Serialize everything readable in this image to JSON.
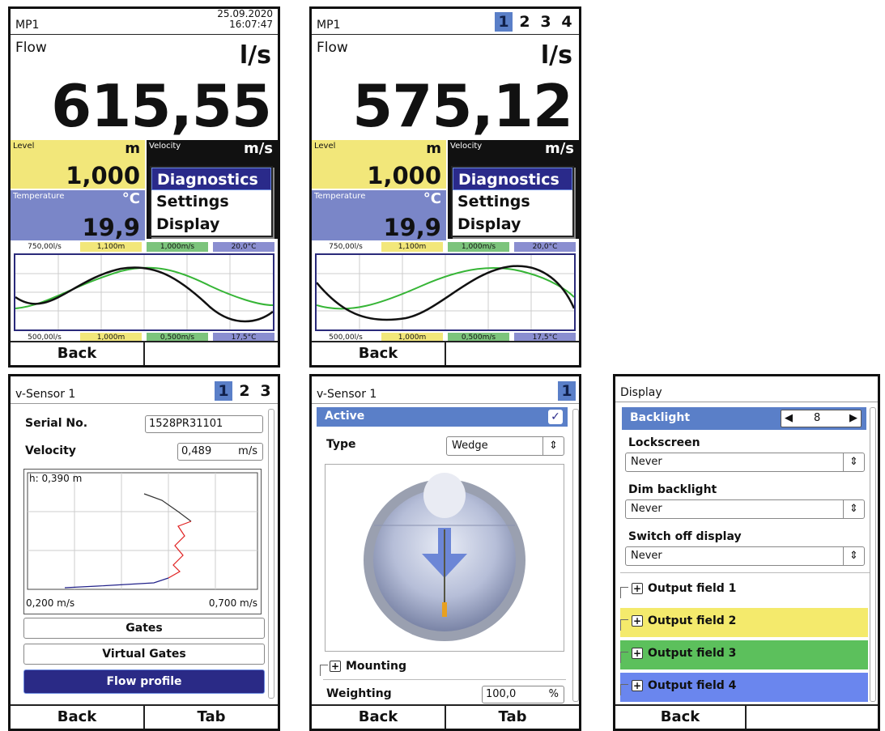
{
  "screen1": {
    "title": "MP1",
    "date": "25.09.2020",
    "time": "16:07:47",
    "flow_label": "Flow",
    "flow_unit": "l/s",
    "flow_value": "615,55",
    "level_label": "Level",
    "level_unit": "m",
    "level_value": "1,000",
    "velocity_label": "Velocity",
    "velocity_unit": "m/s",
    "temperature_label": "Temperature",
    "temperature_unit": "°C",
    "temperature_value": "19,9",
    "menu": [
      "Diagnostics",
      "Settings",
      "Display"
    ],
    "chart_top": [
      "750,00l/s",
      "1,100m",
      "1,000m/s",
      "20,0°C"
    ],
    "chart_bottom": [
      "500,00l/s",
      "1,000m",
      "0,500m/s",
      "17,5°C"
    ],
    "footer": [
      "Back",
      ""
    ]
  },
  "screen2": {
    "title": "MP1",
    "tabs": [
      "1",
      "2",
      "3",
      "4"
    ],
    "flow_label": "Flow",
    "flow_unit": "l/s",
    "flow_value": "575,12",
    "level_label": "Level",
    "level_unit": "m",
    "level_value": "1,000",
    "velocity_label": "Velocity",
    "velocity_unit": "m/s",
    "temperature_label": "Temperature",
    "temperature_unit": "°C",
    "temperature_value": "19,9",
    "menu": [
      "Diagnostics",
      "Settings",
      "Display"
    ],
    "chart_top": [
      "750,00l/s",
      "1,100m",
      "1,000m/s",
      "20,0°C"
    ],
    "chart_bottom": [
      "500,00l/s",
      "1,000m",
      "0,500m/s",
      "17,5°C"
    ],
    "footer": [
      "Back",
      ""
    ]
  },
  "screen3": {
    "title": "v-Sensor 1",
    "tabs": [
      "1",
      "2",
      "3"
    ],
    "serial_label": "Serial No.",
    "serial_value": "1528PR31101",
    "velocity_label": "Velocity",
    "velocity_value": "0,489",
    "velocity_unit": "m/s",
    "profile_h": "h: 0,390 m",
    "profile_xmin": "0,200 m/s",
    "profile_xmax": "0,700 m/s",
    "buttons": [
      "Gates",
      "Virtual Gates",
      "Flow profile"
    ],
    "footer": [
      "Back",
      "Tab"
    ]
  },
  "screen4": {
    "title": "v-Sensor 1",
    "tabs": [
      "1"
    ],
    "active_label": "Active",
    "type_label": "Type",
    "type_value": "Wedge",
    "mounting_label": "Mounting",
    "weighting_label": "Weighting",
    "weighting_value": "100,0",
    "weighting_unit": "%",
    "footer": [
      "Back",
      "Tab"
    ]
  },
  "screen5": {
    "title": "Display",
    "backlight_label": "Backlight",
    "backlight_value": "8",
    "lockscreen_label": "Lockscreen",
    "lockscreen_value": "Never",
    "dim_label": "Dim backlight",
    "dim_value": "Never",
    "switch_label": "Switch off display",
    "switch_value": "Never",
    "outputs": [
      "Output field 1",
      "Output field 2",
      "Output field 3",
      "Output field 4"
    ],
    "footer": [
      "Back",
      ""
    ]
  },
  "colors": {
    "level_bg": "#f2e77a",
    "temperature_bg": "#7a86c8",
    "velocity_line": "#36b536",
    "flow_line": "#111111",
    "selected_blue": "#2a2a8a",
    "output2": "#f4ea6c",
    "output3": "#5cc05c",
    "output4": "#6a86ee"
  }
}
